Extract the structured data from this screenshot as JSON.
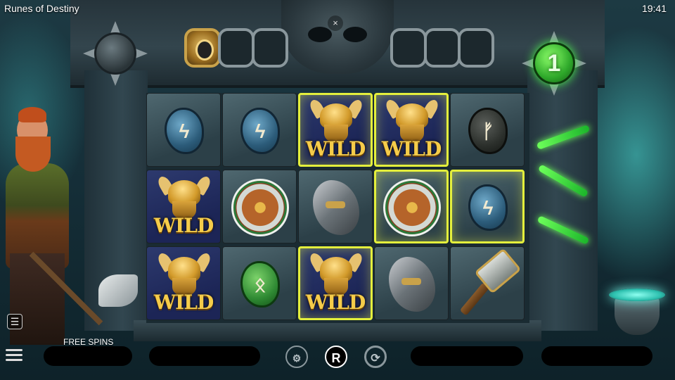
{
  "status_bar": {
    "app_title": "Runes of Destiny",
    "clock": "19:41"
  },
  "top": {
    "close_glyph": "×",
    "free_spins_remaining": "1"
  },
  "rune_collection": {
    "left_slots": [
      "filled",
      "empty",
      "empty"
    ],
    "right_slots": [
      "empty",
      "empty",
      "empty"
    ]
  },
  "reels": [
    [
      {
        "symbol": "blue-rune",
        "glyph": "ϟ",
        "win": false
      },
      {
        "symbol": "wild",
        "label": "WILD",
        "win": false
      },
      {
        "symbol": "wild",
        "label": "WILD",
        "win": false
      }
    ],
    [
      {
        "symbol": "blue-rune",
        "glyph": "ϟ",
        "win": false
      },
      {
        "symbol": "shield",
        "win": false
      },
      {
        "symbol": "green-rune",
        "glyph": "ᛟ",
        "win": false
      }
    ],
    [
      {
        "symbol": "wild",
        "label": "WILD",
        "win": true
      },
      {
        "symbol": "helmet",
        "win": false
      },
      {
        "symbol": "wild",
        "label": "WILD",
        "win": true
      }
    ],
    [
      {
        "symbol": "wild",
        "label": "WILD",
        "win": true
      },
      {
        "symbol": "shield",
        "win": true
      },
      {
        "symbol": "helmet",
        "win": false
      }
    ],
    [
      {
        "symbol": "dark-rune",
        "glyph": "ᚠ",
        "win": false
      },
      {
        "symbol": "blue-rune",
        "glyph": "ϟ",
        "win": true
      },
      {
        "symbol": "hammer",
        "win": false
      }
    ]
  ],
  "hud": {
    "mode_label": "FREE SPINS",
    "autoplay_icon": "coins-gear-icon",
    "logo_glyph": "R",
    "replay_icon": "replay-icon",
    "menu_icon": "hamburger-icon",
    "paytable_icon": "list-icon"
  },
  "colors": {
    "win_outline": "#e4ef3c",
    "free_spin_glow": "#4dff4d"
  }
}
